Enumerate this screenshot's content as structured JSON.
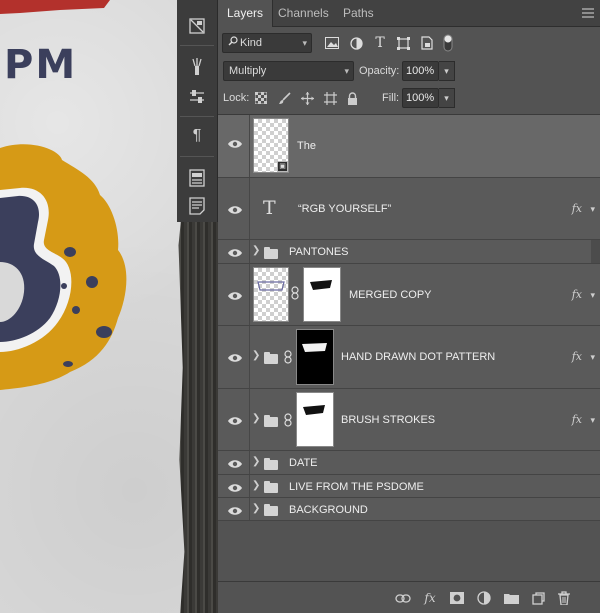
{
  "canvas": {
    "artwork_text": "PM"
  },
  "toolstrip": {
    "icons": [
      "navigator-icon",
      "brush-preset-icon",
      "adjust-sliders-icon",
      "paragraph-icon",
      "properties-icon",
      "notes-icon"
    ],
    "paragraph_glyph": "¶"
  },
  "panel": {
    "tabs": [
      {
        "label": "Layers",
        "active": true
      },
      {
        "label": "Channels",
        "active": false
      },
      {
        "label": "Paths",
        "active": false
      }
    ],
    "filter": {
      "kind_label": "Kind",
      "icons": [
        "image-filter-icon",
        "adjustment-filter-icon",
        "type-filter-icon",
        "shape-filter-icon",
        "smart-object-filter-icon",
        "filter-toggle-icon"
      ]
    },
    "blend": {
      "mode": "Multiply",
      "opacity_label": "Opacity:",
      "opacity_value": "100%"
    },
    "lock": {
      "label": "Lock:",
      "fill_label": "Fill:",
      "fill_value": "100%"
    },
    "layers": [
      {
        "name": "The",
        "kind": "smart-object",
        "selected": true
      },
      {
        "name": "“RGB YOURSELF”",
        "kind": "text",
        "fx": true
      },
      {
        "name": "PANTONES",
        "kind": "group"
      },
      {
        "name": "MERGED COPY",
        "kind": "layer-with-mask",
        "fx": true
      },
      {
        "name": "HAND DRAWN DOT PATTERN",
        "kind": "group-with-mask",
        "fx": true
      },
      {
        "name": "BRUSH STROKES",
        "kind": "group-with-mask",
        "fx": true
      },
      {
        "name": "DATE",
        "kind": "group"
      },
      {
        "name": "LIVE FROM THE PSDOME",
        "kind": "group"
      },
      {
        "name": "BACKGROUND",
        "kind": "group"
      }
    ],
    "fx_label": "fx",
    "type_glyph": "T",
    "footer_icons": [
      "link-layers-icon",
      "fx-icon",
      "add-mask-icon",
      "adjustment-layer-icon",
      "new-group-icon",
      "new-layer-icon",
      "trash-icon"
    ]
  },
  "colors": {
    "panel_bg": "#535353",
    "selected_row": "#686868",
    "artwork_gold": "#d69a16",
    "artwork_navy": "#3b3f5c",
    "artwork_red": "#b3312c"
  }
}
